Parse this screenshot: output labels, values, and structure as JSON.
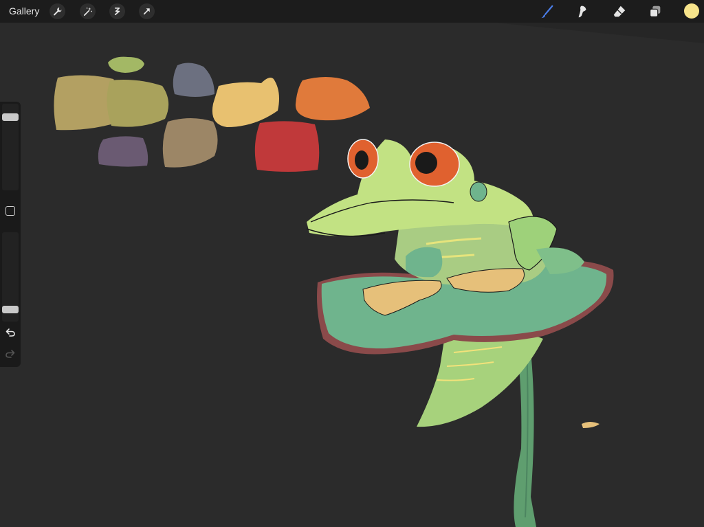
{
  "toolbar": {
    "gallery_label": "Gallery",
    "left_tools": [
      "wrench-icon",
      "magic-wand-icon",
      "selection-icon",
      "transform-arrow-icon"
    ],
    "right_tools": [
      "brush-icon",
      "smudge-icon",
      "eraser-icon",
      "layers-icon"
    ],
    "active_tool": "brush-icon",
    "active_tool_color": "#4a7de8",
    "current_color": "#f7e48b"
  },
  "sidebar": {
    "brush_size_level": 0.88,
    "opacity_level": 0.1,
    "buttons": [
      "modifier-button",
      "undo-icon",
      "redo-icon"
    ]
  },
  "canvas": {
    "background_color": "#2b2b2b",
    "palette_swatches": [
      "#a3b865",
      "#b3a062",
      "#a9a25c",
      "#6c7080",
      "#e8c170",
      "#e07a3b",
      "#6a5a72",
      "#9c8666",
      "#c0393a"
    ]
  }
}
